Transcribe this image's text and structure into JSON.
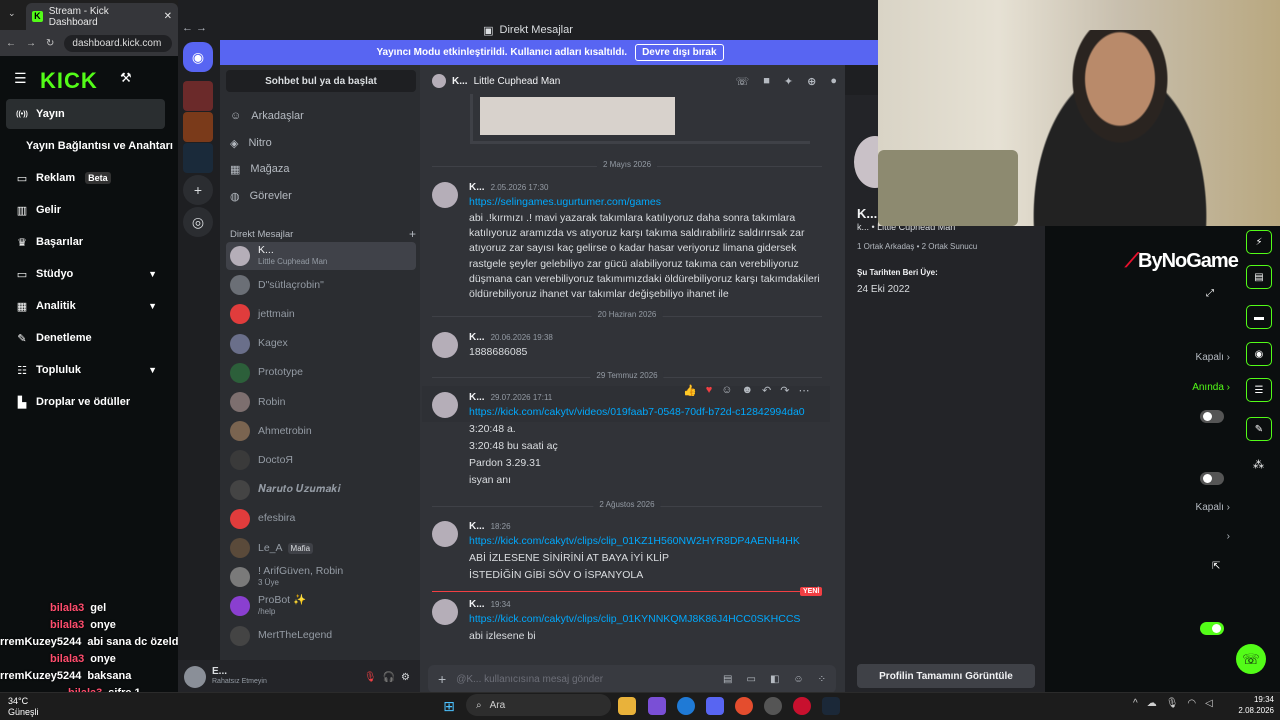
{
  "browser": {
    "tab_title": "Stream - Kick Dashboard",
    "address": "dashboard.kick.com"
  },
  "kick": {
    "logo": "KICK",
    "nav": [
      {
        "label": "Yayın",
        "icon": "broadcast-icon"
      },
      {
        "label": "Yayın Bağlantısı ve Anahtarı",
        "icon": ""
      },
      {
        "label": "Reklam",
        "icon": "ad-icon",
        "badge": "Beta"
      },
      {
        "label": "Gelir",
        "icon": "chart-icon"
      },
      {
        "label": "Başarılar",
        "icon": "trophy-icon"
      },
      {
        "label": "Stüdyo",
        "icon": "studio-icon"
      },
      {
        "label": "Analitik",
        "icon": "analytics-icon"
      },
      {
        "label": "Denetleme",
        "icon": "wrench-icon"
      },
      {
        "label": "Topluluk",
        "icon": "community-icon"
      },
      {
        "label": "Droplar ve ödüller",
        "icon": "drops-icon"
      }
    ],
    "chat": [
      {
        "user": "bilala3",
        "msg": "gel"
      },
      {
        "user": "bilala3",
        "msg": "onye"
      },
      {
        "user": "rremKuzey5244",
        "msg": "abi sana dc özelden bişey attım"
      },
      {
        "user": "bilala3",
        "msg": "onye"
      },
      {
        "user": "rremKuzey5244",
        "msg": "baksana"
      },
      {
        "user": "bilala3",
        "msg": "sifre 1"
      },
      {
        "user": "ndralend123123",
        "msg": "xd"
      }
    ]
  },
  "discord": {
    "window_title": "Direkt Mesajlar",
    "streamer_banner": "Yayıncı Modu etkinleştirildi. Kullanıcı adları kısaltıldı.",
    "banner_button": "Devre dışı bırak",
    "find": "Sohbet bul ya da başlat",
    "nav": [
      "Arkadaşlar",
      "Nitro",
      "Mağaza",
      "Görevler"
    ],
    "dm_header": "Direkt Mesajlar",
    "dms": [
      {
        "name": "K...",
        "sub": "Little Cuphead Man",
        "active": true
      },
      {
        "name": "D\"sütlaçrobin\""
      },
      {
        "name": "jettmain"
      },
      {
        "name": "Kagex"
      },
      {
        "name": "Prototype"
      },
      {
        "name": "Robin"
      },
      {
        "name": "Ahmetrobin"
      },
      {
        "name": "DoctoЯ"
      },
      {
        "name": "𝑵𝒂𝒓𝒖𝒕𝒐 𝑼𝒛𝒖𝒎𝒂𝒌𝒊"
      },
      {
        "name": "efesbira"
      },
      {
        "name": "Le_A",
        "tag": "Mafia"
      },
      {
        "name": "! ArifGüven, Robin",
        "sub": "3 Üye"
      },
      {
        "name": "ProBot ✨",
        "sub": "/help"
      },
      {
        "name": "MertTheLegend"
      }
    ],
    "user": {
      "name": "E...",
      "status": "Rahatsız Etmeyin"
    },
    "chat_header": {
      "name": "K...",
      "sub": "Little Cuphead Man"
    },
    "dates": [
      "2 Mayıs 2026",
      "20 Haziran 2026",
      "29 Temmuz 2026",
      "2 Ağustos 2026"
    ],
    "messages": [
      {
        "author": "K...",
        "time": "2.05.2026 17:30",
        "lines": [
          "https://selingames.ugurtumer.com/games",
          "abi .!kırmızı .! mavi yazarak takımlara katılıyoruz daha sonra takımlara",
          "katılıyoruz aramızda vs atıyoruz karşı takıma saldırabiliriz saldırırsak zar",
          "atıyoruz zar sayısı kaç gelirse o kadar hasar veriyoruz limana gidersek",
          "rastgele şeyler gelebiliyo zar gücü alabiliyoruz takıma can verebiliyoruz",
          "düşmana can verebiliyoruz takımımızdaki öldürebiliyoruz karşı takımdakileri",
          "öldürebiliyoruz ihanet var takımlar değişebiliyo ihanet ile"
        ]
      },
      {
        "author": "K...",
        "time": "20.06.2026 19:38",
        "lines": [
          "1888686085"
        ]
      },
      {
        "author": "K...",
        "time": "29.07.2026 17:11",
        "lines": [
          "https://kick.com/cakytv/videos/019faab7-0548-70df-b72d-c12842994da0",
          "3:20:48 a.",
          "3:20:48 bu saati aç",
          "Pardon 3.29.31",
          "isyan anı"
        ]
      },
      {
        "author": "K...",
        "time": "18:26",
        "lines": [
          "https://kick.com/cakytv/clips/clip_01KZ1H560NW2HYR8DP4AENH4HK",
          "ABİ İZLESENE SİNİRİNİ AT BAYA İYİ KLİP",
          "İSTEDİĞİN GİBİ SÖV O İSPANYOLA"
        ]
      },
      {
        "author": "K...",
        "time": "19:34",
        "lines": [
          "https://kick.com/cakytv/clips/clip_01KYNNKQMJ8K86J4HCC0SKHCCS",
          "abi izlesene bi"
        ]
      }
    ],
    "new_tag": "YENİ",
    "input_placeholder": "@K... kullanıcısına mesaj gönder",
    "profile": {
      "name": "K...",
      "sub": "k...  •  Little Cuphead Man",
      "mutuals": "1 Ortak Arkadaş  •  2 Ortak Sunucu",
      "since_label": "Şu Tarihten Beri Üye:",
      "since": "24 Eki 2022",
      "button": "Profilin Tamamını Görüntüle"
    }
  },
  "dashboard": {
    "brand": "ByNoGame",
    "rows": [
      {
        "label": "Kapalı"
      },
      {
        "label": "Anında"
      },
      {
        "label": "Kapalı"
      }
    ]
  },
  "taskbar": {
    "weather_temp": "34°C",
    "weather_desc": "Güneşli",
    "search": "Ara",
    "time": "19:34",
    "date": "2.08.2026"
  },
  "colors": {
    "kick_green": "#53fc18",
    "discord_blurple": "#5865f2",
    "link": "#00a8fc",
    "new_red": "#f23f43"
  }
}
